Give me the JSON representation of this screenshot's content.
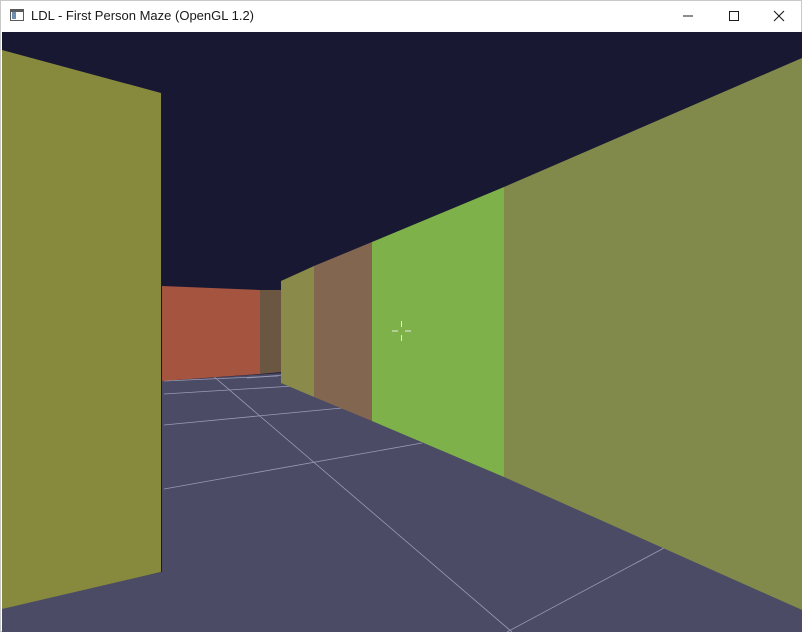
{
  "window": {
    "title": "LDL - First Person Maze (OpenGL 1.2)"
  },
  "controls": {
    "minimize_icon": "minimize-icon",
    "maximize_icon": "maximize-icon",
    "close_icon": "close-icon"
  },
  "scene": {
    "colors": {
      "ceiling": "#191833",
      "floor": "#4b4b66",
      "floor_lines": "#9a9ab4",
      "wall_olive": "#878a3c",
      "wall_olive_right": "#818a4b",
      "wall_red": "#a5543f",
      "wall_dark_brown": "#6b5641",
      "wall_olive_far": "#8a8a4a",
      "wall_brown": "#836650",
      "wall_green": "#7fb14b",
      "crosshair": "#e8e8e8"
    }
  }
}
